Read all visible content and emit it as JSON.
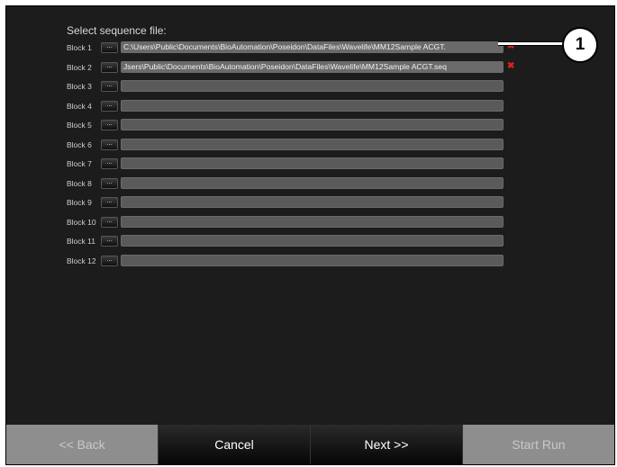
{
  "heading": "Select sequence file:",
  "browse_label": "...",
  "remove_symbol": "✖",
  "blocks": [
    {
      "label": "Block 1",
      "path": "C:\\Users\\Public\\Documents\\BioAutomation\\Poseidon\\DataFiles\\Wavelife\\MM12Sample ACGT.",
      "has_file": true
    },
    {
      "label": "Block 2",
      "path": "Jsers\\Public\\Documents\\BioAutomation\\Poseidon\\DataFiles\\Wavelife\\MM12Sample ACGT.seq",
      "has_file": true
    },
    {
      "label": "Block 3",
      "path": "",
      "has_file": false
    },
    {
      "label": "Block 4",
      "path": "",
      "has_file": false
    },
    {
      "label": "Block 5",
      "path": "",
      "has_file": false
    },
    {
      "label": "Block 6",
      "path": "",
      "has_file": false
    },
    {
      "label": "Block 7",
      "path": "",
      "has_file": false
    },
    {
      "label": "Block 8",
      "path": "",
      "has_file": false
    },
    {
      "label": "Block 9",
      "path": "",
      "has_file": false
    },
    {
      "label": "Block 10",
      "path": "",
      "has_file": false
    },
    {
      "label": "Block 11",
      "path": "",
      "has_file": false
    },
    {
      "label": "Block 12",
      "path": "",
      "has_file": false
    }
  ],
  "nav": {
    "back": "<< Back",
    "cancel": "Cancel",
    "next": "Next >>",
    "start_run": "Start Run"
  },
  "callout": "1",
  "colors": {
    "background": "#1c1c1c",
    "remove_icon": "#e02020",
    "disabled_button": "#8e8e8e"
  }
}
